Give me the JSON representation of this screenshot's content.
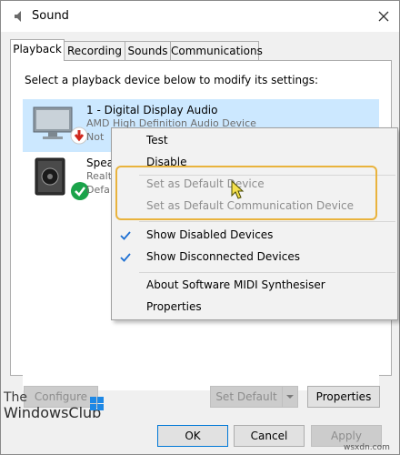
{
  "window": {
    "title": "Sound",
    "close_glyph": "✕"
  },
  "tabs": [
    {
      "label": "Playback",
      "active": true
    },
    {
      "label": "Recording",
      "active": false
    },
    {
      "label": "Sounds",
      "active": false
    },
    {
      "label": "Communications",
      "active": false
    }
  ],
  "instruction": "Select a playback device below to modify its settings:",
  "devices": [
    {
      "name": "1 - Digital Display Audio",
      "sub1": "AMD High Definition Audio Device",
      "sub2": "Not",
      "icon": "monitor-icon",
      "status_icon": "red-down-arrow-icon",
      "selected": true
    },
    {
      "name": "Spea",
      "sub1": "Realt",
      "sub2": "Defa",
      "icon": "speaker-icon",
      "status_icon": "green-check-icon",
      "selected": false
    }
  ],
  "context_menu": {
    "items": [
      {
        "label": "Test",
        "enabled": true,
        "checked": false
      },
      {
        "label": "Disable",
        "enabled": true,
        "checked": false
      },
      {
        "label": "Set as Default Device",
        "enabled": false,
        "checked": false
      },
      {
        "label": "Set as Default Communication Device",
        "enabled": false,
        "checked": false
      },
      {
        "label": "Show Disabled Devices",
        "enabled": true,
        "checked": true
      },
      {
        "label": "Show Disconnected Devices",
        "enabled": true,
        "checked": true
      },
      {
        "label": "About Software MIDI Synthesiser",
        "enabled": true,
        "checked": false
      },
      {
        "label": "Properties",
        "enabled": true,
        "checked": false
      }
    ]
  },
  "buttons": {
    "configure": "Configure",
    "set_default": "Set Default",
    "properties": "Properties",
    "ok": "OK",
    "cancel": "Cancel",
    "apply": "Apply"
  },
  "watermark": {
    "line1": "The",
    "line2": "WindowsClub"
  },
  "credit": "wsxdn.com",
  "colors": {
    "selection": "#cce8ff",
    "highlight_box": "#e9b33d",
    "check_blue": "#1e70d3",
    "accent": "#0078d7",
    "disabled_text": "#8d8d8d"
  }
}
